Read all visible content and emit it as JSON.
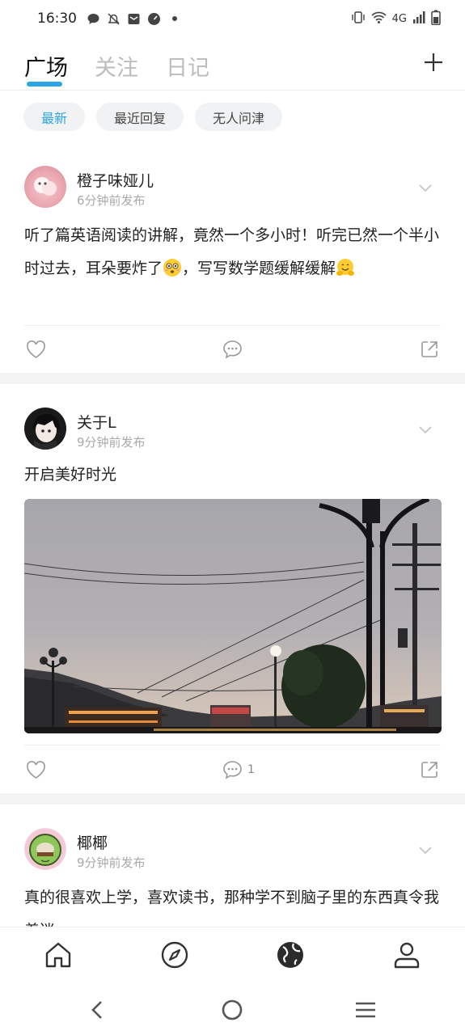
{
  "status_bar": {
    "time": "16:30",
    "network": "4G"
  },
  "tabs": [
    {
      "label": "广场",
      "active": true
    },
    {
      "label": "关注",
      "active": false
    },
    {
      "label": "日记",
      "active": false
    }
  ],
  "filters": [
    {
      "label": "最新",
      "active": true
    },
    {
      "label": "最近回复",
      "active": false
    },
    {
      "label": "无人问津",
      "active": false
    }
  ],
  "posts": [
    {
      "author": "橙子味娅儿",
      "time": "6分钟前发布",
      "text_part1": "听了篇英语阅读的讲解，竟然一个多小时！听完已然一个半小时过去，耳朵要炸了",
      "text_part2": "，写写数学题缓解缓解",
      "comment_count": ""
    },
    {
      "author": "关于L",
      "time": "9分钟前发布",
      "text": "开启美好时光",
      "comment_count": "1"
    },
    {
      "author": "椰椰",
      "time": "9分钟前发布",
      "text": "真的很喜欢上学，喜欢读书，那种学不到脑子里的东西真令我着迷"
    }
  ],
  "colors": {
    "accent": "#2aa6e6",
    "muted": "#aaaaaa",
    "divider": "#f3f3f3"
  },
  "icons": {
    "nav": [
      "home-icon",
      "compass-icon",
      "globe-icon",
      "profile-icon"
    ],
    "post_actions": [
      "heart-icon",
      "comment-icon",
      "share-icon"
    ]
  }
}
